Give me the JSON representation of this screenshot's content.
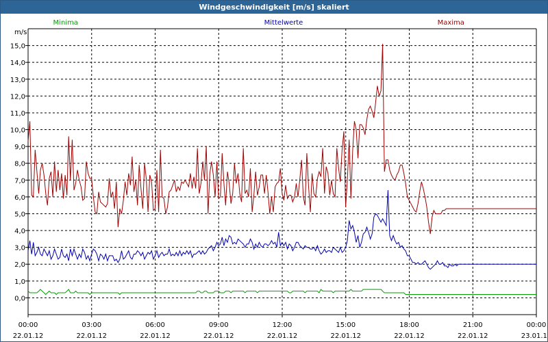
{
  "window": {
    "title": "Windgeschwindigkeit [m/s] skaliert"
  },
  "chart_data": {
    "type": "line",
    "title": "Windgeschwindigkeit [m/s] skaliert",
    "ylabel": "m/s",
    "xlabel": "",
    "ylim": [
      -1.0,
      16.0
    ],
    "xlim": [
      0,
      24
    ],
    "grid": true,
    "legend_position": "top",
    "y_ticks": [
      "0,0",
      "1,0",
      "2,0",
      "3,0",
      "4,0",
      "5,0",
      "6,0",
      "7,0",
      "8,0",
      "9,0",
      "10,0",
      "11,0",
      "12,0",
      "13,0",
      "14,0",
      "15,0"
    ],
    "x_ticks": [
      {
        "time": "00:00",
        "date": "22.01.12"
      },
      {
        "time": "03:00",
        "date": "22.01.12"
      },
      {
        "time": "06:00",
        "date": "22.01.12"
      },
      {
        "time": "09:00",
        "date": "22.01.12"
      },
      {
        "time": "12:00",
        "date": "22.01.12"
      },
      {
        "time": "15:00",
        "date": "22.01.12"
      },
      {
        "time": "18:00",
        "date": "22.01.12"
      },
      {
        "time": "21:00",
        "date": "22.01.12"
      },
      {
        "time": "00:00",
        "date": "23.01.12"
      }
    ],
    "sample_step_hours": 0.0833,
    "series": [
      {
        "name": "Minima",
        "color": "#00a000",
        "values": [
          0.4,
          0.3,
          0.3,
          0.3,
          0.3,
          0.3,
          0.4,
          0.5,
          0.4,
          0.3,
          0.2,
          0.3,
          0.4,
          0.3,
          0.3,
          0.3,
          0.2,
          0.3,
          0.3,
          0.3,
          0.3,
          0.3,
          0.4,
          0.5,
          0.3,
          0.3,
          0.3,
          0.4,
          0.3,
          0.3,
          0.3,
          0.3,
          0.3,
          0.3,
          0.3,
          0.2,
          0.3,
          0.3,
          0.3,
          0.3,
          0.3,
          0.3,
          0.3,
          0.3,
          0.3,
          0.3,
          0.3,
          0.3,
          0.3,
          0.3,
          0.3,
          0.3,
          0.2,
          0.3,
          0.3,
          0.3,
          0.3,
          0.3,
          0.3,
          0.3,
          0.3,
          0.3,
          0.3,
          0.3,
          0.3,
          0.3,
          0.3,
          0.3,
          0.3,
          0.3,
          0.3,
          0.3,
          0.3,
          0.3,
          0.3,
          0.3,
          0.3,
          0.3,
          0.3,
          0.3,
          0.3,
          0.3,
          0.3,
          0.3,
          0.3,
          0.3,
          0.3,
          0.3,
          0.3,
          0.3,
          0.3,
          0.3,
          0.3,
          0.3,
          0.3,
          0.3,
          0.4,
          0.4,
          0.3,
          0.3,
          0.4,
          0.4,
          0.3,
          0.3,
          0.3,
          0.3,
          0.4,
          0.4,
          0.4,
          0.3,
          0.3,
          0.3,
          0.4,
          0.4,
          0.4,
          0.3,
          0.4,
          0.4,
          0.4,
          0.4,
          0.4,
          0.4,
          0.4,
          0.3,
          0.4,
          0.4,
          0.4,
          0.4,
          0.4,
          0.4,
          0.3,
          0.4,
          0.4,
          0.4,
          0.4,
          0.4,
          0.4,
          0.4,
          0.4,
          0.4,
          0.4,
          0.4,
          0.4,
          0.4,
          0.4,
          0.4,
          0.4,
          0.4,
          0.3,
          0.3,
          0.4,
          0.4,
          0.4,
          0.4,
          0.4,
          0.4,
          0.4,
          0.3,
          0.4,
          0.4,
          0.4,
          0.4,
          0.4,
          0.4,
          0.4,
          0.3,
          0.5,
          0.4,
          0.4,
          0.4,
          0.4,
          0.4,
          0.4,
          0.3,
          0.4,
          0.4,
          0.4,
          0.4,
          0.4,
          0.4,
          0.4,
          0.4,
          0.4,
          0.5,
          0.4,
          0.4,
          0.4,
          0.4,
          0.4,
          0.4,
          0.5,
          0.5,
          0.5,
          0.5,
          0.5,
          0.5,
          0.5,
          0.5,
          0.5,
          0.5,
          0.5,
          0.4,
          0.3,
          0.3,
          0.3,
          0.3,
          0.3,
          0.3,
          0.3,
          0.3,
          0.3,
          0.3,
          0.3,
          0.3,
          0.2,
          0.2,
          0.2,
          0.2,
          0.2,
          0.2,
          0.2,
          0.2,
          0.2,
          0.2,
          0.2,
          0.2,
          0.2,
          0.2,
          0.2,
          0.2,
          0.2,
          0.2,
          0.2,
          0.2,
          0.2,
          0.2,
          0.2,
          0.2,
          0.2,
          0.2,
          0.2,
          0.2,
          0.2,
          0.2,
          0.2,
          0.2,
          0.2,
          0.2,
          0.2,
          0.2,
          0.2,
          0.2,
          0.2,
          0.2,
          0.2,
          0.2,
          0.2,
          0.2,
          0.2,
          0.2,
          0.2,
          0.2,
          0.2,
          0.2,
          0.2,
          0.2,
          0.2,
          0.2,
          0.2,
          0.2,
          0.2,
          0.2,
          0.2,
          0.2,
          0.2,
          0.2,
          0.2,
          0.2,
          0.2,
          0.2,
          0.2,
          0.2,
          0.2,
          0.2,
          0.2,
          0.2,
          0.2,
          0.2,
          0.2,
          0.2,
          0.2,
          0.2,
          0.2,
          0.2,
          0.2,
          0.2,
          0.2,
          0.2
        ]
      },
      {
        "name": "Mittelwerte",
        "color": "#0000b0",
        "values": [
          2.8,
          3.4,
          2.6,
          3.3,
          2.5,
          2.7,
          3.0,
          2.6,
          2.5,
          2.9,
          2.7,
          2.5,
          2.8,
          2.3,
          2.5,
          2.9,
          2.6,
          2.3,
          2.4,
          2.9,
          2.5,
          2.4,
          2.6,
          2.2,
          2.9,
          2.5,
          2.9,
          2.6,
          2.3,
          2.6,
          2.4,
          2.9,
          2.7,
          2.3,
          2.5,
          2.2,
          2.6,
          2.9,
          2.8,
          2.6,
          2.2,
          2.6,
          2.5,
          2.3,
          2.6,
          2.2,
          2.5,
          2.5,
          2.5,
          2.2,
          2.3,
          2.1,
          2.3,
          2.8,
          2.3,
          2.4,
          2.6,
          2.8,
          2.4,
          2.3,
          2.6,
          2.6,
          2.8,
          2.7,
          2.5,
          2.7,
          2.3,
          2.5,
          2.7,
          2.6,
          2.8,
          2.3,
          2.5,
          2.8,
          2.4,
          2.6,
          2.7,
          2.5,
          2.6,
          2.6,
          2.9,
          2.5,
          2.6,
          2.5,
          2.7,
          2.5,
          2.8,
          2.5,
          2.7,
          2.6,
          2.8,
          2.6,
          2.8,
          2.4,
          2.6,
          2.6,
          2.7,
          2.8,
          2.6,
          2.8,
          2.6,
          2.7,
          2.9,
          3.0,
          3.1,
          2.8,
          3.0,
          3.3,
          3.1,
          3.2,
          3.6,
          3.1,
          3.5,
          3.3,
          3.7,
          3.6,
          3.2,
          3.3,
          3.2,
          3.5,
          3.4,
          3.3,
          3.2,
          3.0,
          3.2,
          3.2,
          3.5,
          3.3,
          2.9,
          3.2,
          3.0,
          3.3,
          3.1,
          3.0,
          3.2,
          3.2,
          3.1,
          3.2,
          3.4,
          3.2,
          3.3,
          3.0,
          3.9,
          3.1,
          3.3,
          3.1,
          3.3,
          2.9,
          3.2,
          3.1,
          2.8,
          3.0,
          3.3,
          3.3,
          3.1,
          3.0,
          2.9,
          3.1,
          3.0,
          3.0,
          2.9,
          2.9,
          3.0,
          2.8,
          3.1,
          2.8,
          2.6,
          2.7,
          2.9,
          2.7,
          2.8,
          2.8,
          2.7,
          3.0,
          2.9,
          2.8,
          2.7,
          3.0,
          2.7,
          2.8,
          3.0,
          3.4,
          4.6,
          4.1,
          4.3,
          3.9,
          3.3,
          3.7,
          3.0,
          3.3,
          3.8,
          3.9,
          4.2,
          3.9,
          3.5,
          3.8,
          4.8,
          5.0,
          4.9,
          4.7,
          4.5,
          4.7,
          4.5,
          4.3,
          6.4,
          3.7,
          3.4,
          3.7,
          3.4,
          3.2,
          3.3,
          3.0,
          3.1,
          2.9,
          2.8,
          2.5,
          2.5,
          2.3,
          2.1,
          2.1,
          2.0,
          2.1,
          2.0,
          2.0,
          2.1,
          2.2,
          2.0,
          1.8,
          1.7,
          1.8,
          1.9,
          2.0,
          2.2,
          2.0,
          2.0,
          2.1,
          1.9,
          1.9,
          1.8,
          2.0,
          1.9,
          1.9,
          2.0,
          1.9,
          2.0,
          2.0,
          2.0,
          2.0,
          2.0,
          2.0,
          2.0,
          2.0,
          2.0,
          2.0,
          2.0,
          2.0,
          2.0,
          2.0,
          2.0,
          2.0,
          2.0,
          2.0,
          2.0,
          2.0,
          2.0,
          2.0,
          2.0,
          2.0,
          2.0,
          2.0,
          2.0,
          2.0,
          2.0,
          2.0,
          2.0,
          2.0,
          2.0,
          2.0,
          2.0,
          2.0,
          2.0,
          2.0,
          2.0,
          2.0,
          2.0,
          2.0,
          2.0,
          2.0,
          2.0,
          2.0,
          2.0,
          2.0,
          2.0
        ]
      },
      {
        "name": "Maxima",
        "color": "#a00000",
        "values": [
          9.3,
          10.5,
          6.1,
          6.0,
          8.8,
          7.5,
          6.2,
          7.6,
          8.0,
          7.3,
          6.2,
          5.5,
          7.1,
          7.5,
          6.0,
          8.1,
          6.3,
          7.6,
          6.4,
          7.4,
          5.9,
          7.3,
          6.1,
          9.6,
          7.0,
          9.4,
          6.4,
          6.8,
          7.6,
          7.0,
          6.6,
          5.8,
          5.9,
          8.1,
          7.4,
          7.1,
          7.1,
          6.0,
          5.1,
          5.0,
          6.3,
          5.7,
          5.6,
          5.5,
          5.4,
          5.6,
          7.1,
          6.0,
          6.3,
          5.3,
          6.9,
          4.2,
          5.3,
          5.0,
          5.8,
          6.9,
          6.1,
          7.4,
          6.7,
          8.4,
          6.3,
          7.0,
          5.5,
          7.9,
          6.5,
          5.3,
          8.0,
          7.1,
          5.1,
          7.3,
          6.9,
          5.2,
          5.3,
          7.6,
          5.1,
          8.8,
          6.0,
          5.9,
          5.0,
          5.4,
          6.3,
          6.4,
          6.7,
          7.0,
          6.3,
          6.6,
          6.4,
          6.9,
          6.8,
          7.0,
          6.8,
          6.6,
          7.4,
          6.5,
          7.2,
          6.5,
          8.9,
          6.2,
          6.8,
          8.1,
          7.0,
          9.0,
          5.0,
          7.4,
          8.1,
          7.3,
          6.0,
          8.1,
          5.9,
          6.0,
          8.6,
          6.8,
          5.5,
          7.5,
          6.8,
          5.6,
          6.2,
          8.0,
          6.8,
          7.4,
          6.2,
          5.7,
          8.9,
          6.2,
          6.4,
          6.0,
          7.7,
          5.1,
          6.1,
          7.5,
          6.1,
          6.6,
          7.3,
          7.3,
          6.2,
          7.3,
          6.3,
          5.0,
          6.0,
          5.1,
          6.6,
          6.8,
          6.9,
          7.7,
          6.2,
          5.8,
          6.7,
          5.9,
          6.1,
          6.1,
          5.7,
          6.0,
          6.8,
          6.0,
          7.0,
          8.2,
          6.0,
          5.5,
          8.6,
          6.6,
          5.1,
          7.4,
          6.2,
          6.0,
          7.1,
          7.5,
          7.2,
          8.9,
          6.2,
          7.8,
          7.4,
          6.1,
          7.0,
          6.2,
          6.0,
          8.9,
          7.7,
          6.9,
          8.8,
          9.9,
          5.4,
          7.0,
          9.4,
          5.9,
          8.8,
          10.5,
          10.0,
          8.3,
          10.3,
          10.3,
          10.1,
          9.7,
          10.6,
          11.2,
          11.4,
          11.1,
          10.7,
          11.6,
          12.6,
          12.0,
          12.3,
          15.1,
          7.5,
          8.2,
          8.2,
          7.6,
          7.3,
          7.1,
          7.0,
          7.3,
          7.5,
          7.9,
          7.9,
          7.4,
          6.8,
          6.0,
          5.8,
          5.6,
          5.4,
          5.2,
          5.1,
          5.6,
          6.3,
          6.9,
          6.5,
          6.0,
          5.4,
          4.5,
          3.8,
          4.8,
          5.2,
          5.0,
          5.0,
          5.0,
          5.0,
          5.2,
          5.2,
          5.3,
          5.3,
          5.3,
          5.3,
          5.3,
          5.3,
          5.3,
          5.3,
          5.3,
          5.3,
          5.3,
          5.3,
          5.3,
          5.3,
          5.3,
          5.3,
          5.3,
          5.3,
          5.3,
          5.3,
          5.3,
          5.3,
          5.3,
          5.3,
          5.3,
          5.3,
          5.3,
          5.3,
          5.3,
          5.3,
          5.3,
          5.3,
          5.3,
          5.3,
          5.3,
          5.3,
          5.3,
          5.3,
          5.3,
          5.3,
          5.3,
          5.3,
          5.3,
          5.3,
          5.3,
          5.3,
          5.3,
          5.3,
          5.3,
          5.3,
          5.3,
          5.3,
          5.3,
          5.3,
          5.3,
          5.3,
          5.3,
          5.3,
          5.3,
          5.3,
          5.3,
          5.3,
          5.3
        ]
      }
    ]
  }
}
